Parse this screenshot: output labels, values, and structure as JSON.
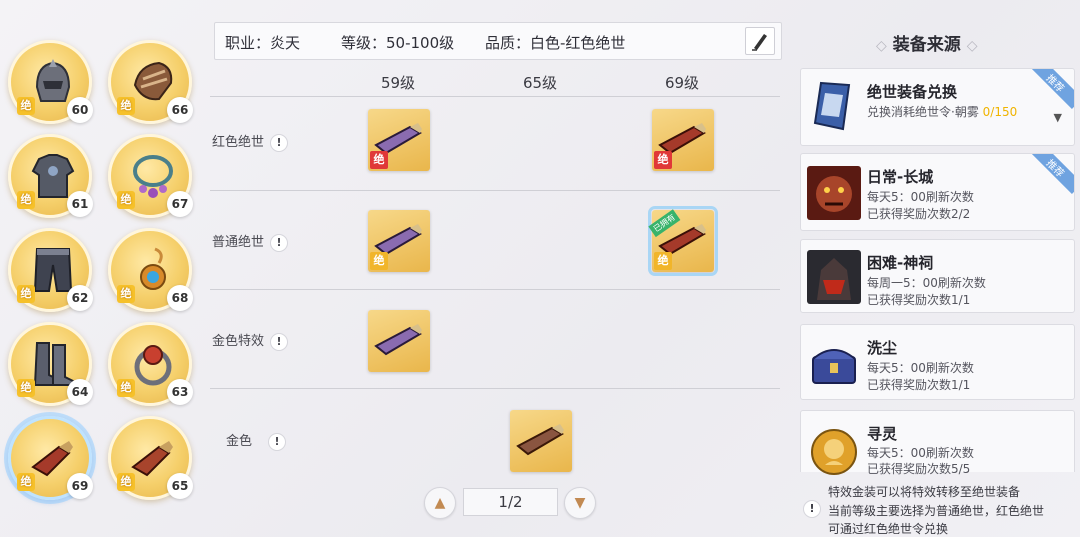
{
  "slots": [
    {
      "icon": "helmet-icon",
      "level": "60",
      "tag": "绝"
    },
    {
      "icon": "pauldron-icon",
      "level": "66",
      "tag": "绝"
    },
    {
      "icon": "chest-armor-icon",
      "level": "61",
      "tag": "绝"
    },
    {
      "icon": "necklace-icon",
      "level": "67",
      "tag": "绝"
    },
    {
      "icon": "pants-icon",
      "level": "62",
      "tag": "绝"
    },
    {
      "icon": "earring-icon",
      "level": "68",
      "tag": "绝"
    },
    {
      "icon": "boots-icon",
      "level": "64",
      "tag": "绝"
    },
    {
      "icon": "ring-icon",
      "level": "63",
      "tag": "绝"
    },
    {
      "icon": "hand-cannon-icon",
      "level": "69",
      "tag": "绝"
    },
    {
      "icon": "hand-cannon-icon",
      "level": "65",
      "tag": "绝"
    }
  ],
  "header": {
    "job_label": "职业：",
    "job_value": "炎天",
    "level_label": "等级：",
    "level_value": "50-100级",
    "quality_label": "品质：",
    "quality_value": "白色-红色绝世",
    "edit_icon": "pen-icon"
  },
  "table": {
    "columns": [
      "59级",
      "65级",
      "69级"
    ],
    "rows": [
      {
        "label": "红色绝世",
        "info": "!"
      },
      {
        "label": "普通绝世",
        "info": "!"
      },
      {
        "label": "金色特效",
        "info": "!"
      },
      {
        "label": "金色",
        "info": "!"
      }
    ],
    "cell_tag": "绝",
    "owned_badge": "已拥有"
  },
  "pager": {
    "text": "1/2",
    "prev_icon": "chevron-up-icon",
    "next_icon": "chevron-down-icon"
  },
  "sources": {
    "title": "装备来源",
    "cards": [
      {
        "name": "绝世装备兑换",
        "line1_prefix": "兑换消耗绝世令·朝雾 ",
        "line1_value": "0/150",
        "recommend": "推荐"
      },
      {
        "name": "日常-长城",
        "line1": "每天5：00刷新次数",
        "line2": "已获得奖励次数2/2",
        "recommend": "推荐"
      },
      {
        "name": "困难-神祠",
        "line1": "每周一5：00刷新次数",
        "line2": "已获得奖励次数1/1"
      },
      {
        "name": "洗尘",
        "line1": "每天5：00刷新次数",
        "line2": "已获得奖励次数1/1"
      },
      {
        "name": "寻灵",
        "line1": "每天5：00刷新次数",
        "line2": "已获得奖励次数5/5"
      }
    ]
  },
  "note": {
    "lines": [
      "特效金装可以将特效转移至绝世装备",
      "当前等级主要选择为普通绝世，红色绝世",
      "可通过红色绝世令兑换"
    ],
    "info": "!"
  },
  "colors": {
    "accent_gold": "#f1b52a",
    "red_tag": "#e03838",
    "progress_yellow": "#f0b400",
    "recommend_blue": "#6fa3e0"
  }
}
